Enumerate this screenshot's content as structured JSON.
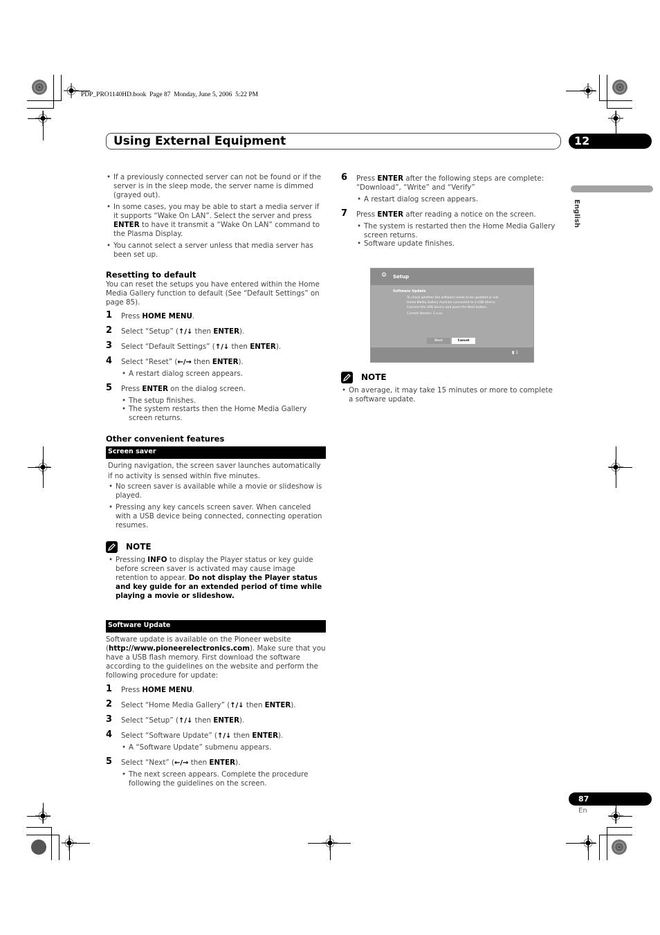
{
  "print_info": "PDP_PRO1140HD.book  Page 87  Monday, June 5, 2006  5:22 PM",
  "header": {
    "title": "Using External Equipment",
    "chapter_number": "12"
  },
  "side_tab": {
    "language": "English"
  },
  "footer": {
    "page_number": "87",
    "page_lang": "En"
  },
  "left_column": {
    "intro_bullets": [
      {
        "text": "If a previously connected server can not be found or if the server is in the sleep mode, the server name is dimmed (grayed out)."
      },
      {
        "pre": "In some cases, you may be able to start a media server if it supports “Wake On LAN”. Select the server and press ",
        "bold": "ENTER",
        "post": " to have it transmit a “Wake On LAN” command to the Plasma Display."
      },
      {
        "text": "You cannot select a server unless that media server has been set up."
      }
    ],
    "resetting": {
      "heading": "Resetting to default",
      "intro": "You can reset the setups you have entered within the Home Media Gallery function to default (See “Default Settings” on page 85).",
      "steps": [
        {
          "num": "1",
          "pre": "Press ",
          "bold": "HOME MENU",
          "post": "."
        },
        {
          "num": "2",
          "pre": "Select “Setup” (",
          "arrows": "↑/↓",
          "mid": " then ",
          "bold": "ENTER",
          "post": ")."
        },
        {
          "num": "3",
          "pre": "Select “Default Settings” (",
          "arrows": "↑/↓",
          "mid": " then ",
          "bold": "ENTER",
          "post": ")."
        },
        {
          "num": "4",
          "pre": "Select “Reset” (",
          "arrows": "←/→",
          "mid": " then ",
          "bold": "ENTER",
          "post": ").",
          "subs": [
            "A restart dialog screen appears."
          ]
        },
        {
          "num": "5",
          "pre": "Press ",
          "bold": "ENTER",
          "post": " on the dialog screen.",
          "subs": [
            "The setup finishes.",
            "The system restarts then the Home Media Gallery screen returns."
          ]
        }
      ]
    },
    "other_features": {
      "heading": "Other convenient features",
      "screen_saver": {
        "bar_label": "Screen saver",
        "intro": "During navigation, the screen saver launches automatically if no activity is sensed within five minutes.",
        "bullets": [
          "No screen saver is available while a movie or slideshow is played.",
          "Pressing any key cancels screen saver. When canceled with a USB device being connected, connecting operation resumes."
        ],
        "note": {
          "title": "NOTE",
          "pre": "Pressing ",
          "bold1": "INFO",
          "mid": " to display the Player status or key guide before screen saver is activated may cause image retention to appear. ",
          "bold2": "Do not display the Player status and key guide for an extended period of time while playing a movie or slideshow."
        }
      },
      "software_update": {
        "bar_label": "Software Update",
        "intro_pre": "Software update is available on the Pioneer website (",
        "intro_bold": "http://www.pioneerelectronics.com",
        "intro_post": ").  Make sure that you have a USB flash memory. First download the software according to the guidelines on the website and perform the following procedure for update:",
        "steps": [
          {
            "num": "1",
            "pre": "Press ",
            "bold": "HOME MENU",
            "post": "."
          },
          {
            "num": "2",
            "pre": "Select “Home Media Gallery” (",
            "arrows": "↑/↓",
            "mid": " then ",
            "bold": "ENTER",
            "post": ")."
          },
          {
            "num": "3",
            "pre": "Select “Setup” (",
            "arrows": "↑/↓",
            "mid": " then ",
            "bold": "ENTER",
            "post": ")."
          },
          {
            "num": "4",
            "pre": "Select “Software Update” (",
            "arrows": "↑/↓",
            "mid": " then ",
            "bold": "ENTER",
            "post": ").",
            "subs": [
              "A “Software Update” submenu appears."
            ]
          },
          {
            "num": "5",
            "pre": "Select “Next” (",
            "arrows": "←/→",
            "mid": " then ",
            "bold": "ENTER",
            "post": ").",
            "subs": [
              "The next screen appears. Complete the procedure following the guidelines on the screen."
            ]
          }
        ]
      }
    }
  },
  "right_column": {
    "steps": [
      {
        "num": "6",
        "pre": "Press ",
        "bold": "ENTER",
        "post": " after the following steps are complete: “Download”, “Write” and “Verify”",
        "subs": [
          "A restart dialog screen appears."
        ]
      },
      {
        "num": "7",
        "pre": "Press ",
        "bold": "ENTER",
        "post": " after reading a notice on the screen.",
        "subs": [
          "The system is restarted then the Home Media Gallery screen returns.",
          "Software update finishes."
        ]
      }
    ],
    "screen": {
      "title": "Setup",
      "subtitle": "Software Update",
      "lines": [
        "To check whether the software needs to be updated or not.",
        "Home Media Gallery must be connected to a USB device.",
        "Connect the USB device and press the Next button."
      ],
      "version": "Current Version: 1.x.xx",
      "next_label": "Next",
      "cancel_label": "Cancel",
      "footer_indicator": "1"
    },
    "note": {
      "title": "NOTE",
      "text": "On average, it may take 15 minutes or more to complete a software update."
    }
  }
}
